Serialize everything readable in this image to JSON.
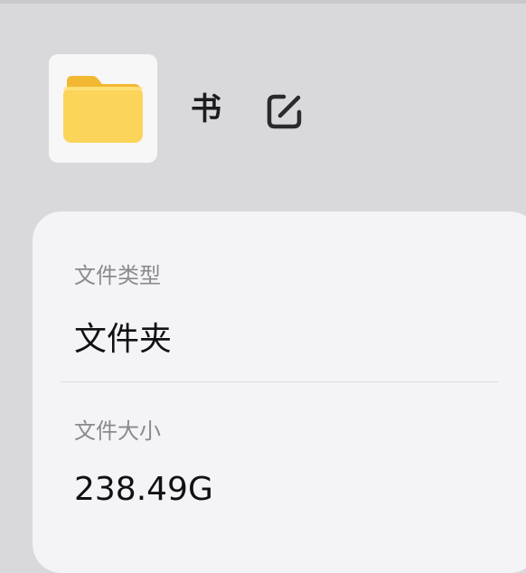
{
  "header": {
    "folder_name": "书",
    "folder_icon": "folder-icon",
    "edit_icon": "edit-icon",
    "folder_color": "#F9CC45"
  },
  "info": {
    "type_label": "文件类型",
    "type_value": "文件夹",
    "size_label": "文件大小",
    "size_value": "238.49G"
  }
}
